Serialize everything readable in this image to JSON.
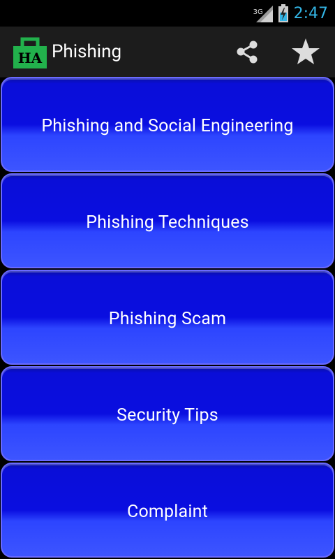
{
  "status_bar": {
    "network": "3G",
    "time": "2:47"
  },
  "action_bar": {
    "icon_text": "HA",
    "title": "Phishing",
    "share_icon": "share-icon",
    "favorite_icon": "star-icon"
  },
  "menu": {
    "items": [
      {
        "label": "Phishing and Social Engineering"
      },
      {
        "label": "Phishing Techniques"
      },
      {
        "label": "Phishing Scam"
      },
      {
        "label": "Security Tips"
      },
      {
        "label": "Complaint"
      }
    ]
  },
  "colors": {
    "accent_clock": "#33b5e5",
    "button_blue": "#0a0ee0",
    "icon_green": "#22b14c"
  }
}
